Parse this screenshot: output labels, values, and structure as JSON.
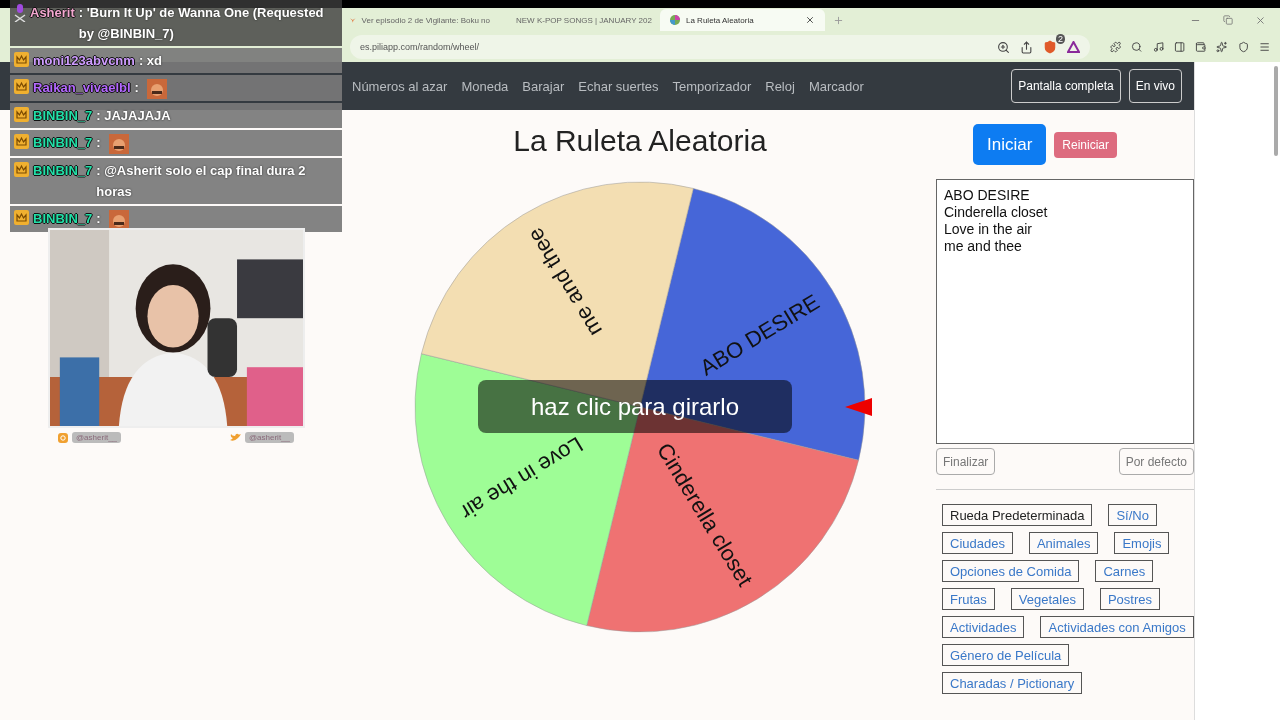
{
  "browser": {
    "tabs": [
      {
        "title": "Ver episodio 2 de Vigilante: Boku no",
        "selected": false,
        "kind": "anime"
      },
      {
        "title": "NEW K-POP SONGS | JANUARY 202",
        "selected": false,
        "kind": "video"
      },
      {
        "title": "La Ruleta Aleatoria",
        "selected": true,
        "kind": "wheel"
      }
    ],
    "address": "es.piliapp.com/random/wheel/",
    "shields_count": "2"
  },
  "nav": {
    "items": [
      "Números al azar",
      "Moneda",
      "Barajar",
      "Echar suertes",
      "Temporizador",
      "Reloj",
      "Marcador"
    ],
    "buttons": [
      "Pantalla completa",
      "En vivo"
    ]
  },
  "wheel": {
    "title": "La Ruleta Aleatoria",
    "overlay": "haz clic para girarlo",
    "segments": [
      {
        "label": "ABO DESIRE",
        "color": "#4666d8"
      },
      {
        "label": "Cinderella closet",
        "color": "#ef7272"
      },
      {
        "label": "Love in the air",
        "color": "#9efd96"
      },
      {
        "label": "me and thee",
        "color": "#f3deb2"
      }
    ]
  },
  "panel": {
    "start": "Iniciar",
    "reset": "Reiniciar",
    "entries": [
      "ABO DESIRE",
      "Cinderella closet",
      "Love in the air",
      "me and thee"
    ],
    "finish": "Finalizar",
    "default": "Por defecto",
    "presets": [
      {
        "label": "Rueda Predeterminada",
        "selected": true
      },
      {
        "label": "Sí/No",
        "selected": false
      },
      {
        "label": "Ciudades",
        "selected": false
      },
      {
        "label": "Animales",
        "selected": false
      },
      {
        "label": "Emojis",
        "selected": false
      },
      {
        "label": "Opciones de Comida",
        "selected": false
      },
      {
        "label": "Carnes",
        "selected": false
      },
      {
        "label": "Frutas",
        "selected": false
      },
      {
        "label": "Vegetales",
        "selected": false
      },
      {
        "label": "Postres",
        "selected": false
      },
      {
        "label": "Actividades",
        "selected": false
      },
      {
        "label": "Actividades con Amigos",
        "selected": false
      },
      {
        "label": "Género de Película",
        "selected": false
      },
      {
        "label": "Charadas / Pictionary",
        "selected": false
      }
    ]
  },
  "chat": [
    {
      "badge": {
        "kind": "mic"
      },
      "user": "Asherit",
      "color": "#f4a8d0",
      "kind": "text",
      "message": ": 'Burn It Up' de Wanna One (Requested by @BINBIN_7)"
    },
    {
      "badge": {
        "kind": "crown"
      },
      "user": "moni123abvcnm",
      "color": "#cf9cff",
      "kind": "text",
      "message": ": xd"
    },
    {
      "badge": {
        "kind": "crown"
      },
      "user": "Raikan_vivaelbl",
      "color": "#b468ff",
      "kind": "emote",
      "message": ":"
    },
    {
      "badge": {
        "kind": "crown"
      },
      "user": "BINBIN_7",
      "color": "#22e0a8",
      "kind": "text",
      "message": ": JAJAJAJA"
    },
    {
      "badge": {
        "kind": "crown"
      },
      "user": "BINBIN_7",
      "color": "#22e0a8",
      "kind": "emote",
      "message": ":"
    },
    {
      "badge": {
        "kind": "crown"
      },
      "user": "BINBIN_7",
      "color": "#22e0a8",
      "kind": "text",
      "message": ": @Asherit solo el cap final dura 2 horas"
    },
    {
      "badge": {
        "kind": "crown"
      },
      "user": "BINBIN_7",
      "color": "#22e0a8",
      "kind": "emote",
      "message": ":"
    }
  ],
  "stream": {
    "handles": [
      {
        "kind": "instagram",
        "handle": "@asherit__"
      },
      {
        "kind": "twitter",
        "handle": "@asherit__"
      }
    ]
  }
}
